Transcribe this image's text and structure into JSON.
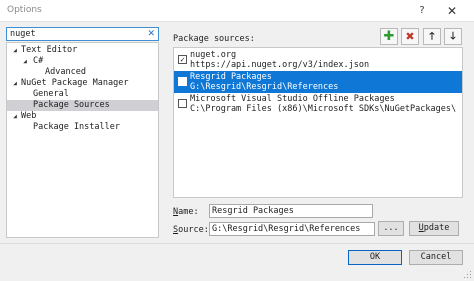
{
  "window": {
    "title": "Options",
    "help_glyph": "?",
    "close_glyph": "✕"
  },
  "search": {
    "value": "nuget",
    "clear_glyph": "✕"
  },
  "tree": [
    {
      "label": "Text Editor",
      "toggle": "◢"
    },
    {
      "label": "C#",
      "toggle": "◢"
    },
    {
      "label": "Advanced",
      "toggle": ""
    },
    {
      "label": "NuGet Package Manager",
      "toggle": "◢"
    },
    {
      "label": "General",
      "toggle": ""
    },
    {
      "label": "Package Sources",
      "toggle": "",
      "selected": true
    },
    {
      "label": "Web",
      "toggle": "◢"
    },
    {
      "label": "Package Installer",
      "toggle": ""
    }
  ],
  "sources_panel": {
    "label": "Package sources:",
    "toolbar": {
      "add_icon": "add-icon",
      "add_glyph": "✚",
      "remove_icon": "remove-icon",
      "remove_glyph": "✖",
      "up_glyph": "🡑",
      "down_glyph": "🡓"
    },
    "sources": [
      {
        "name": "nuget.org",
        "path": "https://api.nuget.org/v3/index.json",
        "checked": true,
        "check_glyph": "✓"
      },
      {
        "name": "Resgrid Packages",
        "path": "G:\\Resgrid\\Resgrid\\References",
        "checked": false,
        "check_glyph": ""
      },
      {
        "name": "Microsoft Visual Studio Offline Packages",
        "path": "C:\\Program Files (x86)\\Microsoft SDKs\\NuGetPackages\\",
        "checked": false,
        "check_glyph": ""
      }
    ]
  },
  "form": {
    "name_label_accel": "N",
    "name_label_rest": "ame:",
    "name_value": "Resgrid Packages",
    "source_label_accel": "S",
    "source_label_rest": "ource:",
    "source_value": "G:\\Resgrid\\Resgrid\\References",
    "browse_label": "...",
    "update_label_accel": "U",
    "update_label_rest": "pdate"
  },
  "footer": {
    "ok_label": "OK",
    "cancel_label": "Cancel"
  },
  "colors": {
    "selection": "#0f78d7",
    "tree_selection": "#cfcfd4",
    "add_green": "#2f9a2f",
    "remove_red": "#c0392b"
  }
}
